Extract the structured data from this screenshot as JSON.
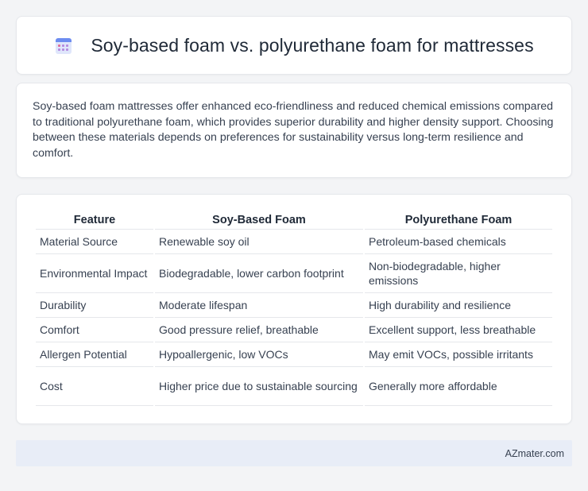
{
  "header": {
    "title": "Soy-based foam vs. polyurethane foam for mattresses",
    "icon": "calendar-icon"
  },
  "summary": {
    "text": "Soy-based foam mattresses offer enhanced eco-friendliness and reduced chemical emissions compared to traditional polyurethane foam, which provides superior durability and higher density support. Choosing between these materials depends on preferences for sustainability versus long-term resilience and comfort."
  },
  "table": {
    "headers": [
      "Feature",
      "Soy-Based Foam",
      "Polyurethane Foam"
    ],
    "rows": [
      [
        "Material Source",
        "Renewable soy oil",
        "Petroleum-based chemicals"
      ],
      [
        "Environmental Impact",
        "Biodegradable, lower carbon footprint",
        "Non-biodegradable, higher emissions"
      ],
      [
        "Durability",
        "Moderate lifespan",
        "High durability and resilience"
      ],
      [
        "Comfort",
        "Good pressure relief, breathable",
        "Excellent support, less breathable"
      ],
      [
        "Allergen Potential",
        "Hypoallergenic, low VOCs",
        "May emit VOCs, possible irritants"
      ],
      [
        "Cost",
        "Higher price due to sustainable sourcing",
        "Generally more affordable"
      ]
    ]
  },
  "footer": {
    "brand": "AZmater.com"
  },
  "colors": {
    "background": "#f3f4f6",
    "card": "#ffffff",
    "footer_bg": "#e8edf7",
    "icon_accent": "#6d8cf0"
  }
}
